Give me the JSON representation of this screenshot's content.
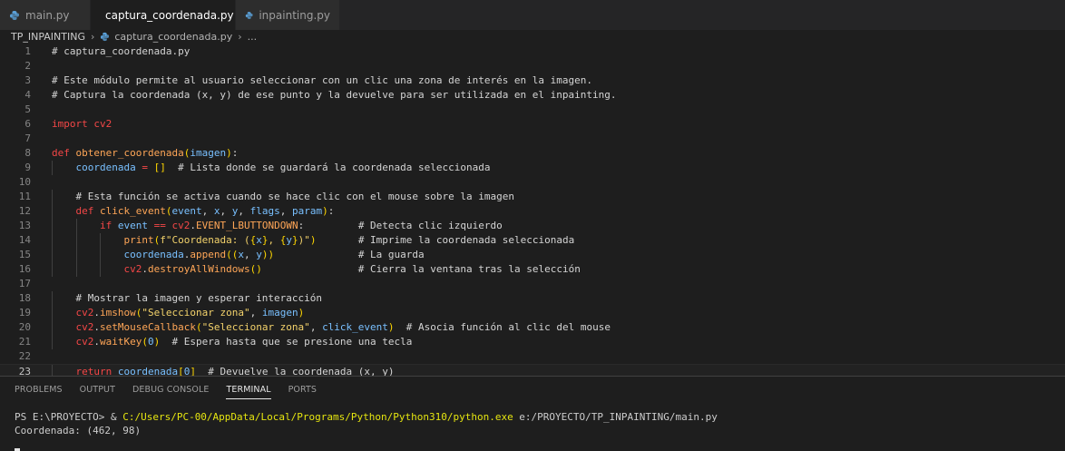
{
  "tabs": [
    {
      "label": "main.py",
      "active": false,
      "icon": "python-icon"
    },
    {
      "label": "captura_coordenada.py",
      "active": true,
      "icon": "python-icon"
    },
    {
      "label": "inpainting.py",
      "active": false,
      "icon": "python-icon"
    }
  ],
  "breadcrumb": {
    "folder": "TP_INPAINTING",
    "file": "captura_coordenada.py",
    "more": "..."
  },
  "editor": {
    "current_line": 23,
    "line_numbers": [
      "1",
      "2",
      "3",
      "4",
      "5",
      "6",
      "7",
      "8",
      "9",
      "10",
      "11",
      "12",
      "13",
      "14",
      "15",
      "16",
      "17",
      "18",
      "19",
      "20",
      "21",
      "22",
      "23"
    ],
    "lines": [
      "# captura_coordenada.py",
      "",
      "# Este módulo permite al usuario seleccionar con un clic una zona de interés en la imagen.",
      "# Captura la coordenada (x, y) de ese punto y la devuelve para ser utilizada en el inpainting.",
      "",
      "import cv2",
      "",
      "def obtener_coordenada(imagen):",
      "    coordenada = []  # Lista donde se guardará la coordenada seleccionada",
      "",
      "    # Esta función se activa cuando se hace clic con el mouse sobre la imagen",
      "    def click_event(event, x, y, flags, param):",
      "        if event == cv2.EVENT_LBUTTONDOWN:         # Detecta clic izquierdo",
      "            print(f\"Coordenada: ({x}, {y})\")       # Imprime la coordenada seleccionada",
      "            coordenada.append((x, y))              # La guarda",
      "            cv2.destroyAllWindows()                # Cierra la ventana tras la selección",
      "",
      "    # Mostrar la imagen y esperar interacción",
      "    cv2.imshow(\"Seleccionar zona\", imagen)",
      "    cv2.setMouseCallback(\"Seleccionar zona\", click_event)  # Asocia función al clic del mouse",
      "    cv2.waitKey(0)  # Espera hasta que se presione una tecla",
      "",
      "    return coordenada[0]  # Devuelve la coordenada (x, y)"
    ]
  },
  "panel": {
    "tabs": [
      "PROBLEMS",
      "OUTPUT",
      "DEBUG CONSOLE",
      "TERMINAL",
      "PORTS"
    ],
    "active_tab": "TERMINAL",
    "terminal": {
      "prompt": "PS E:\\PROYECTO> & ",
      "exe": "C:/Users/PC-00/AppData/Local/Programs/Python/Python310/python.exe",
      "script": " e:/PROYECTO/TP_INPAINTING/main.py",
      "output": "Coordenada: (462, 98)"
    }
  },
  "colors": {
    "background": "#1e1e1e",
    "tab_inactive": "#2d2d2d",
    "comment": "#d4d4d4",
    "keyword": "#f44747",
    "function": "#ffa657",
    "string": "#f3d26b",
    "variable": "#79c0ff",
    "terminal_path": "#e5e510"
  }
}
